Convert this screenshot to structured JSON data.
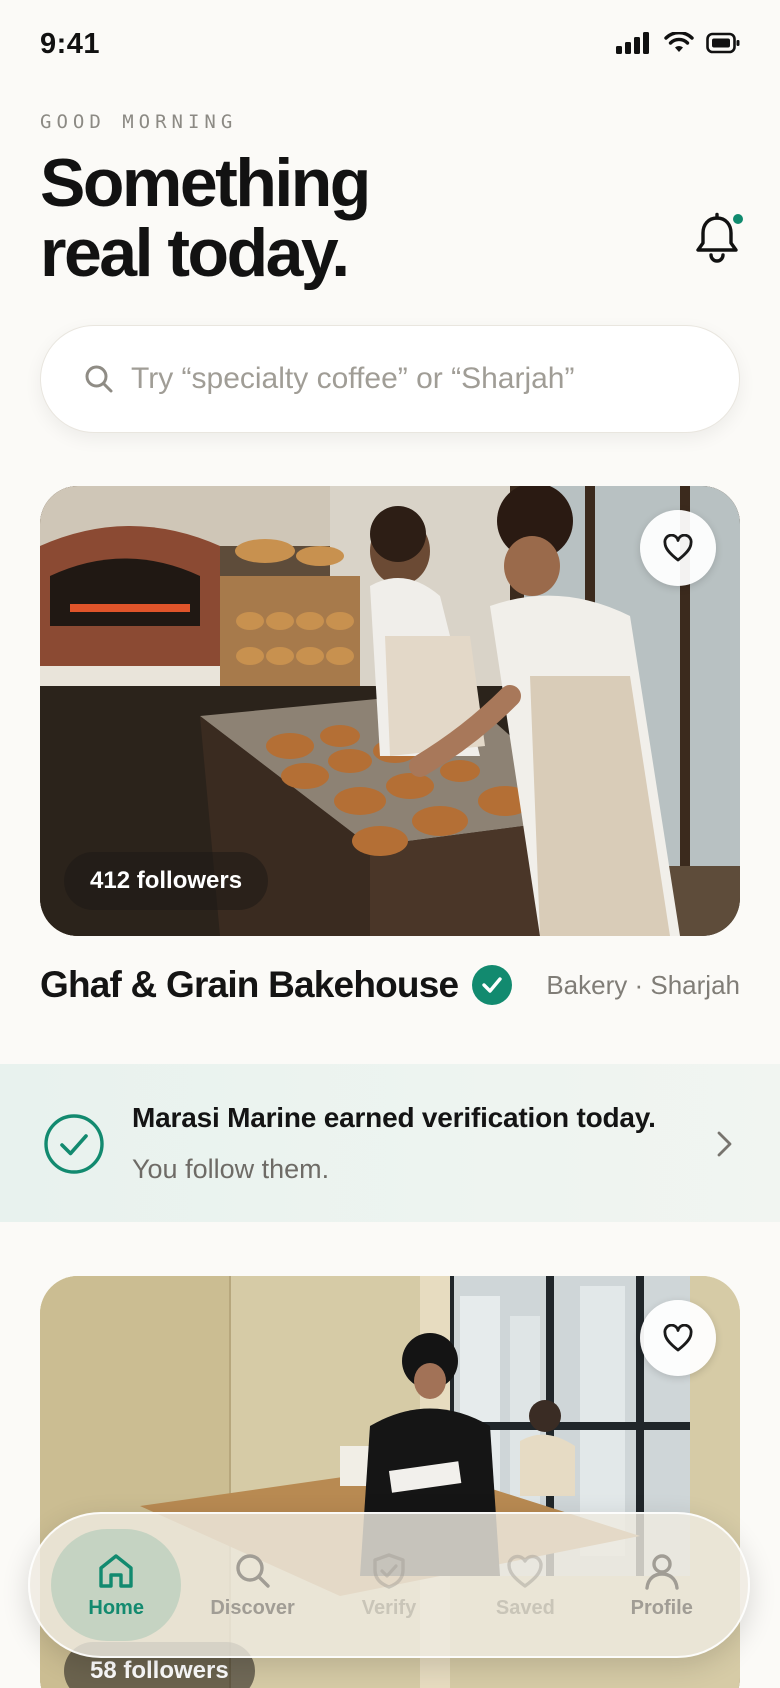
{
  "status_bar": {
    "time": "9:41"
  },
  "header": {
    "greeting": "GOOD MORNING",
    "headline_line1": "Something",
    "headline_line2": "real today."
  },
  "search": {
    "placeholder": "Try “specialty coffee” or “Sharjah”"
  },
  "cards": [
    {
      "title": "Ghaf & Grain Bakehouse",
      "verified": true,
      "meta": "Bakery · Sharjah",
      "followers": "412 followers",
      "favorited": false
    },
    {
      "title": "",
      "followers": "58 followers",
      "favorited": false
    }
  ],
  "notice": {
    "title": "Marasi Marine earned verification today.",
    "subtitle": "You follow them."
  },
  "tabs": [
    {
      "label": "Home",
      "icon": "home-icon",
      "active": true
    },
    {
      "label": "Discover",
      "icon": "search-icon",
      "active": false
    },
    {
      "label": "Verify",
      "icon": "shield-check-icon",
      "active": false
    },
    {
      "label": "Saved",
      "icon": "heart-icon",
      "active": false
    },
    {
      "label": "Profile",
      "icon": "person-icon",
      "active": false
    }
  ],
  "colors": {
    "accent": "#128A6F",
    "background": "#FBFAF7",
    "notice_background": "#E8F2EE",
    "muted_text": "#807D77"
  }
}
